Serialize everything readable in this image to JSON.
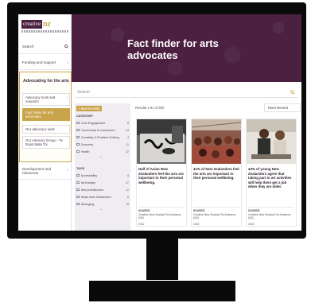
{
  "logo": {
    "text": "creative",
    "accent": "nz"
  },
  "sidebar": {
    "items": [
      {
        "label": "Search",
        "icon": "search-icon"
      },
      {
        "label": "Funding and support",
        "icon": "chevron-right-icon"
      }
    ],
    "advocacy": {
      "title": "Advocating for the arts",
      "items": [
        {
          "label": "Advocacy tools and research",
          "icon": "chevron-right-icon",
          "active": false
        },
        {
          "label": "Fact finder for arts advocates",
          "active": true
        },
        {
          "label": "Our advocacy work",
          "active": false
        },
        {
          "label": "Our Advisory Group – Te Ropū Mata Toi",
          "active": false
        }
      ]
    },
    "development": {
      "label": "Development and resources",
      "icon": "chevron-right-icon"
    }
  },
  "header": {
    "title": "Fact finder for arts advocates"
  },
  "search": {
    "placeholder": "Search",
    "icon": "search-icon"
  },
  "filters": {
    "button": "+ HIDE FILTERS",
    "category_heading": "CATEGORY",
    "categories": [
      {
        "label": "Civic Engagement",
        "count": "8"
      },
      {
        "label": "Community & Connection",
        "count": "14"
      },
      {
        "label": "Creativity & Problem Solving",
        "count": "4"
      },
      {
        "label": "Economy",
        "count": "11"
      },
      {
        "label": "Health",
        "count": "32"
      }
    ],
    "tags_heading": "TAGS",
    "tags": [
      {
        "label": "Accessibility",
        "count": "8"
      },
      {
        "label": "Art therapy",
        "count": "37"
      },
      {
        "label": "Arts practitioners",
        "count": "12"
      },
      {
        "label": "Asian New Zealanders",
        "count": "6"
      },
      {
        "label": "Belonging",
        "count": "78"
      }
    ],
    "more_icon": "chevron-down-icon"
  },
  "results": {
    "count_text": "Results 1-91 of 500",
    "sort_label": "Most Recent",
    "cards": [
      {
        "title": "Half of Asian New Zealanders feel the arts are important to their personal wellbeing.",
        "source_label": "SOURCE",
        "source": "Creative New Zealand Toi Aotearoa (NZ)",
        "year": "2022"
      },
      {
        "title": "41% of New Zealanders feel the arts are important to their personal wellbeing.",
        "source_label": "SOURCE",
        "source": "Creative New Zealand Toi Aotearoa (NZ)",
        "year": "2022"
      },
      {
        "title": "43% of young New Zealanders agree that taking part in art activities will help them get a job when they are older.",
        "source_label": "SOURCE",
        "source": "Creative New Zealand Toi Aotearoa (NZ)",
        "year": "2022"
      }
    ]
  },
  "colors": {
    "brand": "#4b2040",
    "accent": "#c9a44a"
  }
}
